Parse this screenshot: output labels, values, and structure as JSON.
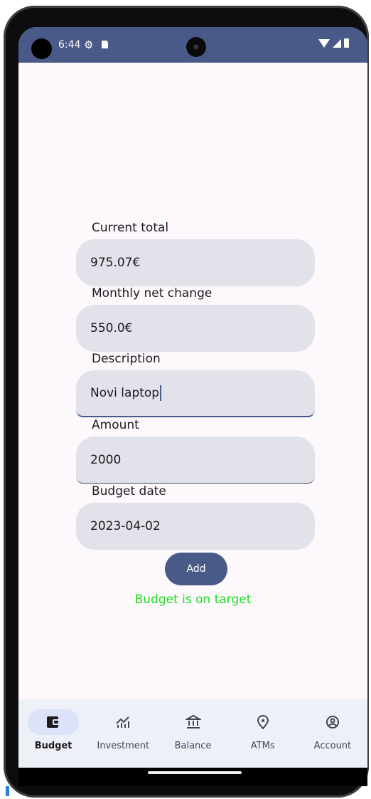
{
  "status_bar": {
    "time": "6:44",
    "gear_icon": "settings-gear",
    "sd_icon": "sd-card",
    "wifi_icon": "wifi",
    "signal_icon": "cell-signal",
    "battery_icon": "battery"
  },
  "form": {
    "current_total": {
      "label": "Current total",
      "value": "975.07€"
    },
    "monthly_net_change": {
      "label": "Monthly net change",
      "value": "550.0€"
    },
    "description": {
      "label": "Description",
      "value": "Novi laptop"
    },
    "amount": {
      "label": "Amount",
      "value": "2000"
    },
    "budget_date": {
      "label": "Budget date",
      "value": "2023-04-02"
    },
    "add_button": "Add",
    "status_message": "Budget is on target",
    "status_color": "#22dd22"
  },
  "bottom_nav": {
    "items": [
      {
        "label": "Budget",
        "icon": "wallet-icon",
        "active": true
      },
      {
        "label": "Investment",
        "icon": "chart-icon",
        "active": false
      },
      {
        "label": "Balance",
        "icon": "bank-icon",
        "active": false
      },
      {
        "label": "ATMs",
        "icon": "location-pin-icon",
        "active": false
      },
      {
        "label": "Account",
        "icon": "account-circle-icon",
        "active": false
      }
    ]
  },
  "colors": {
    "primary": "#4a5a88",
    "field_bg": "#e2e2ea",
    "screen_bg": "#fcf8fb",
    "nav_bg": "#eef0f7"
  }
}
